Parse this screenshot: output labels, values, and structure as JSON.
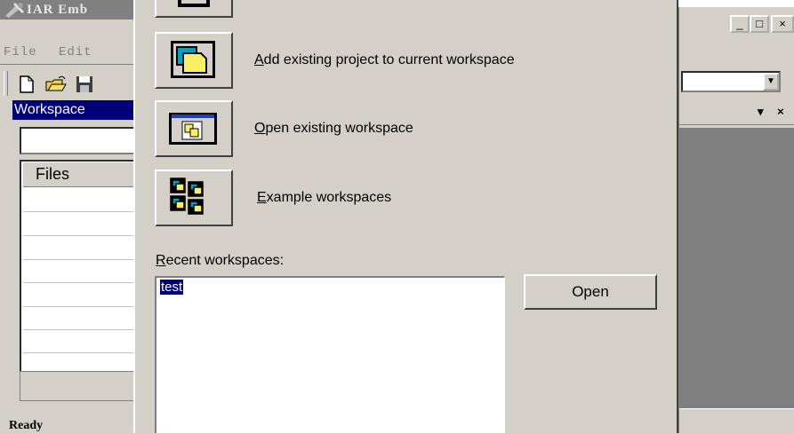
{
  "ide": {
    "title": "IAR Emb",
    "menu": [
      "File",
      "Edit"
    ],
    "workspace_title": "Workspace",
    "files_header": "Files",
    "status": "Ready",
    "window_controls": [
      "_",
      "□",
      "×"
    ],
    "pane_controls": "▾ ×"
  },
  "dialog": {
    "actions": [
      {
        "hotkey": "A",
        "rest": "dd existing project to current workspace",
        "icon": "add-project-icon"
      },
      {
        "hotkey": "O",
        "rest": "pen existing workspace",
        "icon": "open-workspace-icon"
      },
      {
        "hotkey": "E",
        "rest": "xample workspaces",
        "icon": "example-workspaces-icon"
      }
    ],
    "recent_label_hotkey": "R",
    "recent_label_rest": "ecent workspaces:",
    "recent_items": [
      "test"
    ],
    "open_label": "Open"
  }
}
